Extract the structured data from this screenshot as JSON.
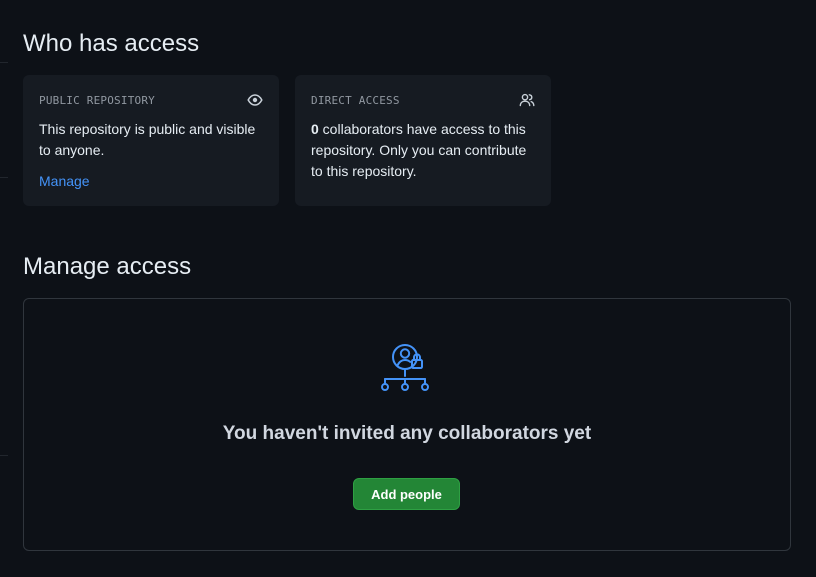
{
  "who_has_access": {
    "heading": "Who has access",
    "public_card": {
      "label": "PUBLIC REPOSITORY",
      "icon": "eye-icon",
      "text": "This repository is public and visible to anyone.",
      "link": "Manage"
    },
    "direct_card": {
      "label": "DIRECT ACCESS",
      "icon": "people-icon",
      "count": "0",
      "text": " collaborators have access to this repository. Only you can contribute to this repository."
    }
  },
  "manage_access": {
    "heading": "Manage access",
    "empty_state": {
      "icon": "person-lock-network-icon",
      "title": "You haven't invited any collaborators yet",
      "button_label": "Add people"
    }
  },
  "colors": {
    "background": "#0d1117",
    "card_bg": "#161b22",
    "border": "#30363d",
    "accent_link": "#4493f8",
    "button_green": "#238636"
  }
}
